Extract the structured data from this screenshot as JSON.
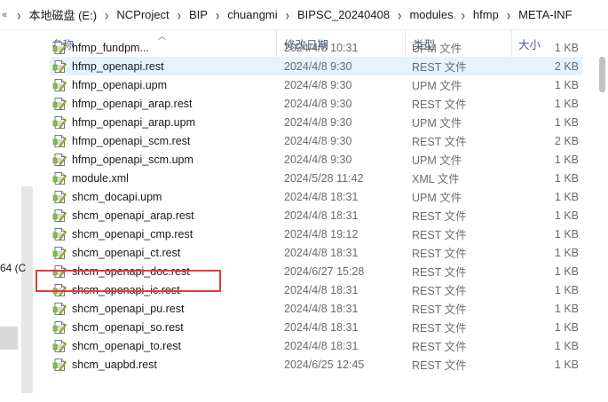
{
  "breadcrumb": {
    "overflow": "«",
    "items": [
      "本地磁盘 (E:)",
      "NCProject",
      "BIP",
      "chuangmi",
      "BIPSC_20240408",
      "modules",
      "hfmp",
      "META-INF"
    ],
    "separator": "›"
  },
  "nav": {
    "fragment_label": "64 (C"
  },
  "columns": {
    "name": "名称",
    "date": "修改日期",
    "type": "类型",
    "size": "大小"
  },
  "files": [
    {
      "name": "hfmp_fundpm...",
      "date": "2024/4/8 10:31",
      "type": "UPM 文件",
      "size": "1 KB",
      "kind": "generic"
    },
    {
      "name": "hfmp_openapi.rest",
      "date": "2024/4/8 9:30",
      "type": "REST 文件",
      "size": "2 KB",
      "kind": "generic"
    },
    {
      "name": "hfmp_openapi.upm",
      "date": "2024/4/8 9:30",
      "type": "UPM 文件",
      "size": "1 KB",
      "kind": "generic"
    },
    {
      "name": "hfmp_openapi_arap.rest",
      "date": "2024/4/8 9:30",
      "type": "REST 文件",
      "size": "1 KB",
      "kind": "generic"
    },
    {
      "name": "hfmp_openapi_arap.upm",
      "date": "2024/4/8 9:30",
      "type": "UPM 文件",
      "size": "1 KB",
      "kind": "generic"
    },
    {
      "name": "hfmp_openapi_scm.rest",
      "date": "2024/4/8 9:30",
      "type": "REST 文件",
      "size": "2 KB",
      "kind": "generic"
    },
    {
      "name": "hfmp_openapi_scm.upm",
      "date": "2024/4/8 9:30",
      "type": "UPM 文件",
      "size": "1 KB",
      "kind": "generic"
    },
    {
      "name": "module.xml",
      "date": "2024/5/28 11:42",
      "type": "XML 文件",
      "size": "1 KB",
      "kind": "xml"
    },
    {
      "name": "shcm_docapi.upm",
      "date": "2024/4/8 18:31",
      "type": "UPM 文件",
      "size": "1 KB",
      "kind": "generic"
    },
    {
      "name": "shcm_openapi_arap.rest",
      "date": "2024/4/8 18:31",
      "type": "REST 文件",
      "size": "1 KB",
      "kind": "generic"
    },
    {
      "name": "shcm_openapi_cmp.rest",
      "date": "2024/4/8 19:12",
      "type": "REST 文件",
      "size": "1 KB",
      "kind": "generic"
    },
    {
      "name": "shcm_openapi_ct.rest",
      "date": "2024/4/8 18:31",
      "type": "REST 文件",
      "size": "1 KB",
      "kind": "generic"
    },
    {
      "name": "shcm_openapi_doc.rest",
      "date": "2024/6/27 15:28",
      "type": "REST 文件",
      "size": "1 KB",
      "kind": "generic"
    },
    {
      "name": "shcm_openapi_ic.rest",
      "date": "2024/4/8 18:31",
      "type": "REST 文件",
      "size": "1 KB",
      "kind": "generic"
    },
    {
      "name": "shcm_openapi_pu.rest",
      "date": "2024/4/8 18:31",
      "type": "REST 文件",
      "size": "1 KB",
      "kind": "generic"
    },
    {
      "name": "shcm_openapi_so.rest",
      "date": "2024/4/8 18:31",
      "type": "REST 文件",
      "size": "1 KB",
      "kind": "generic"
    },
    {
      "name": "shcm_openapi_to.rest",
      "date": "2024/4/8 18:31",
      "type": "REST 文件",
      "size": "1 KB",
      "kind": "generic"
    },
    {
      "name": "shcm_uapbd.rest",
      "date": "2024/6/25 12:45",
      "type": "REST 文件",
      "size": "1 KB",
      "kind": "generic"
    }
  ],
  "hover_index": 1,
  "highlighted_index": 12,
  "colors": {
    "hover_bg": "#e5f3ff",
    "highlight_border": "#e03c3c",
    "header_text": "#4d6082"
  }
}
